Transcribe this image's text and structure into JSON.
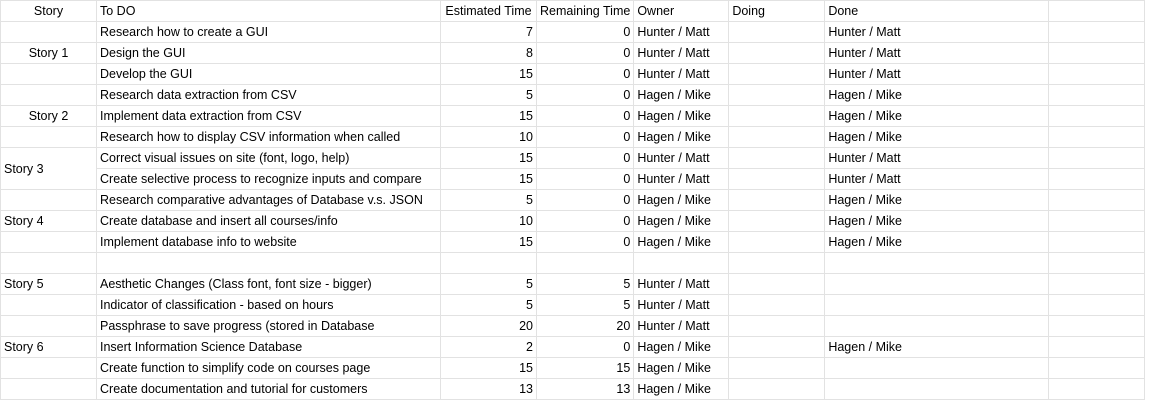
{
  "headers": {
    "story": "Story",
    "todo": "To DO",
    "estimated": "Estimated Time",
    "remaining": "Remaining Time",
    "owner": "Owner",
    "doing": "Doing",
    "done": "Done"
  },
  "rows": [
    {
      "story": "",
      "todo": "Research how to create a GUI",
      "est": "7",
      "rem": "0",
      "owner": "Hunter / Matt",
      "doing": "",
      "done": "Hunter / Matt"
    },
    {
      "story": "Story 1",
      "todo": "Design the GUI",
      "est": "8",
      "rem": "0",
      "owner": "Hunter / Matt",
      "doing": "",
      "done": "Hunter / Matt"
    },
    {
      "story": "",
      "todo": "Develop the GUI",
      "est": "15",
      "rem": "0",
      "owner": "Hunter / Matt",
      "doing": "",
      "done": "Hunter / Matt"
    },
    {
      "story": "",
      "todo": "Research data extraction from CSV",
      "est": "5",
      "rem": "0",
      "owner": "Hagen / Mike",
      "doing": "",
      "done": "Hagen / Mike"
    },
    {
      "story": "Story 2",
      "todo": "Implement data extraction from CSV",
      "est": "15",
      "rem": "0",
      "owner": "Hagen / Mike",
      "doing": "",
      "done": "Hagen / Mike"
    },
    {
      "story": "",
      "todo": "Research how to display CSV information when called",
      "est": "10",
      "rem": "0",
      "owner": "Hagen / Mike",
      "doing": "",
      "done": "Hagen / Mike"
    },
    {
      "story": "",
      "todo": "Correct visual issues on site (font, logo, help)",
      "est": "15",
      "rem": "0",
      "owner": "Hunter / Matt",
      "doing": "",
      "done": "Hunter / Matt"
    },
    {
      "story": "",
      "todo": "Create selective process to recognize inputs and compare",
      "est": "15",
      "rem": "0",
      "owner": "Hunter / Matt",
      "doing": "",
      "done": "Hunter / Matt"
    },
    {
      "story": "",
      "todo": "Research comparative advantages of Database v.s. JSON",
      "est": "5",
      "rem": "0",
      "owner": "Hagen / Mike",
      "doing": "",
      "done": "Hagen / Mike"
    },
    {
      "story": "Story 4",
      "todo": "Create database and insert all courses/info",
      "est": "10",
      "rem": "0",
      "owner": "Hagen / Mike",
      "doing": "",
      "done": "Hagen / Mike"
    },
    {
      "story": "",
      "todo": "Implement database info to website",
      "est": "15",
      "rem": "0",
      "owner": "Hagen / Mike",
      "doing": "",
      "done": "Hagen / Mike"
    },
    {
      "story": "",
      "todo": "",
      "est": "",
      "rem": "",
      "owner": "",
      "doing": "",
      "done": ""
    },
    {
      "story": "Story 5",
      "todo": "Aesthetic Changes (Class font, font size - bigger)",
      "est": "5",
      "rem": "5",
      "owner": "Hunter / Matt",
      "doing": "",
      "done": ""
    },
    {
      "story": "",
      "todo": "Indicator of classification - based on hours",
      "est": "5",
      "rem": "5",
      "owner": "Hunter / Matt",
      "doing": "",
      "done": ""
    },
    {
      "story": "",
      "todo": "Passphrase to save progress (stored in Database",
      "est": "20",
      "rem": "20",
      "owner": "Hunter / Matt",
      "doing": "",
      "done": ""
    },
    {
      "story": "Story 6",
      "todo": "Insert Information Science Database",
      "est": "2",
      "rem": "0",
      "owner": "Hagen / Mike",
      "doing": "",
      "done": "Hagen / Mike"
    },
    {
      "story": "",
      "todo": "Create function to simplify code on courses page",
      "est": "15",
      "rem": "15",
      "owner": "Hagen / Mike",
      "doing": "",
      "done": ""
    },
    {
      "story": "",
      "todo": "Create documentation and tutorial for customers",
      "est": "13",
      "rem": "13",
      "owner": "Hagen / Mike",
      "doing": "",
      "done": ""
    }
  ],
  "merged_story": {
    "story3": "Story 3"
  }
}
